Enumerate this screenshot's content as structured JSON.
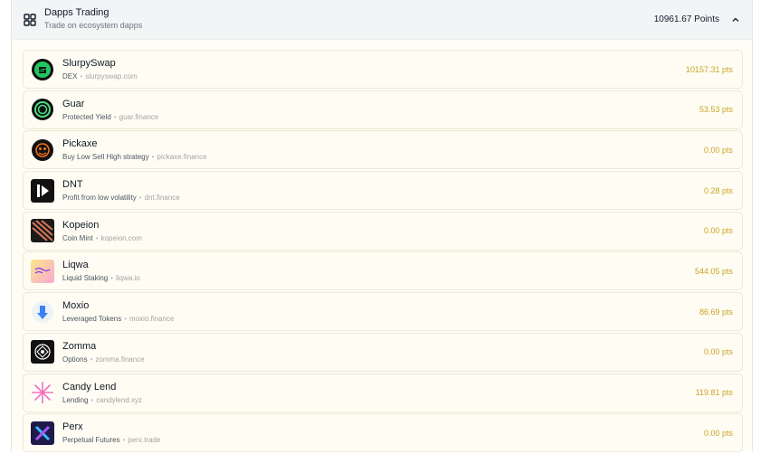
{
  "header": {
    "title": "Dapps Trading",
    "subtitle": "Trade on ecosystem dapps",
    "points": "10961.67 Points",
    "grid_icon": "grid-icon",
    "collapse_icon": "chevron-up-icon"
  },
  "dapps": [
    {
      "name": "SlurpySwap",
      "category": "DEX",
      "url": "slurpyswap.com",
      "points": "10157.31 pts",
      "logo": "slurpyswap-logo",
      "color": "#22c55e"
    },
    {
      "name": "Guar",
      "category": "Protected Yield",
      "url": "guar.finance",
      "points": "53.53 pts",
      "logo": "guar-logo",
      "color": "#4ade80"
    },
    {
      "name": "Pickaxe",
      "category": "Buy Low Sell High strategy",
      "url": "pickaxe.finance",
      "points": "0.00 pts",
      "logo": "pickaxe-logo",
      "color": "#f97316"
    },
    {
      "name": "DNT",
      "category": "Profit from low volatility",
      "url": "dnt.finance",
      "points": "0.28 pts",
      "logo": "dnt-logo",
      "color": "#111111"
    },
    {
      "name": "Kopeion",
      "category": "Coin Mint",
      "url": "kopeion.com",
      "points": "0.00 pts",
      "logo": "kopeion-logo",
      "color": "#d97757"
    },
    {
      "name": "Liqwa",
      "category": "Liquid Staking",
      "url": "liqwa.io",
      "points": "544.05 pts",
      "logo": "liqwa-logo",
      "color": "#f9a8d4"
    },
    {
      "name": "Moxio",
      "category": "Leveraged Tokens",
      "url": "moxio.finance",
      "points": "86.69 pts",
      "logo": "moxio-logo",
      "color": "#3b82f6"
    },
    {
      "name": "Zomma",
      "category": "Options",
      "url": "zomma.finance",
      "points": "0.00 pts",
      "logo": "zomma-logo",
      "color": "#111111"
    },
    {
      "name": "Candy Lend",
      "category": "Lending",
      "url": "candylend.xyz",
      "points": "119.81 pts",
      "logo": "candylend-logo",
      "color": "#f472b6"
    },
    {
      "name": "Perx",
      "category": "Perpetual Futures",
      "url": "perx.trade",
      "points": "0.00 pts",
      "logo": "perx-logo",
      "color": "#1e1b4b"
    }
  ]
}
